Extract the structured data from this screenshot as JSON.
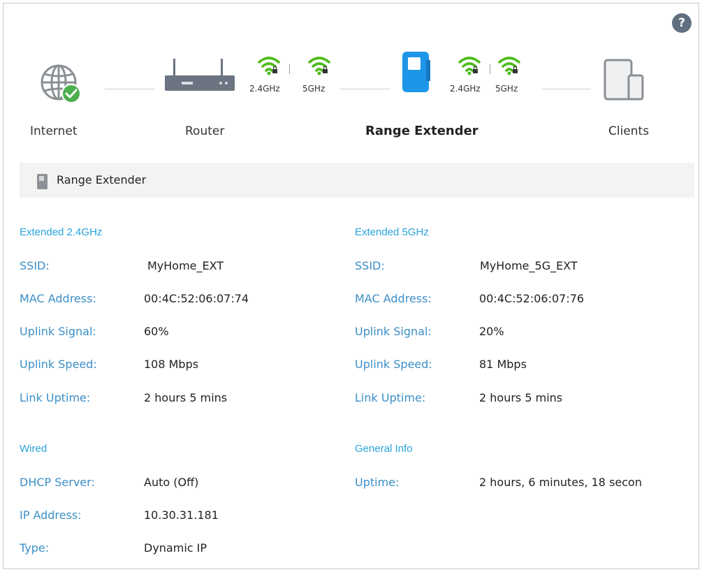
{
  "help": {
    "symbol": "?"
  },
  "topology": {
    "internet_label": "Internet",
    "router_label": "Router",
    "extender_label": "Range Extender",
    "clients_label": "Clients",
    "router_bands": [
      "2.4GHz",
      "5GHz"
    ],
    "extender_bands": [
      "2.4GHz",
      "5GHz"
    ],
    "accent_color": "#1e96e8",
    "wifi_color": "#4cbb17",
    "status_color": "#4cae4c"
  },
  "section": {
    "title": "Range Extender"
  },
  "ext24": {
    "title": "Extended 2.4GHz",
    "ssid_label": "SSID:",
    "ssid": "MyHome_EXT",
    "mac_label": "MAC Address:",
    "mac": "00:4C:52:06:07:74",
    "signal_label": "Uplink Signal:",
    "signal": "60%",
    "speed_label": "Uplink Speed:",
    "speed": "108 Mbps",
    "uptime_label": "Link Uptime:",
    "uptime": "2 hours 5 mins"
  },
  "ext5": {
    "title": "Extended 5GHz",
    "ssid_label": "SSID:",
    "ssid": "MyHome_5G_EXT",
    "mac_label": "MAC Address:",
    "mac": "00:4C:52:06:07:76",
    "signal_label": "Uplink Signal:",
    "signal": "20%",
    "speed_label": "Uplink Speed:",
    "speed": "81 Mbps",
    "uptime_label": "Link Uptime:",
    "uptime": "2 hours 5 mins"
  },
  "wired": {
    "title": "Wired",
    "dhcp_label": "DHCP Server:",
    "dhcp": "Auto (Off)",
    "ip_label": "IP Address:",
    "ip": "10.30.31.181",
    "type_label": "Type:",
    "type": "Dynamic IP"
  },
  "general": {
    "title": "General Info",
    "uptime_label": "Uptime:",
    "uptime": "2 hours, 6 minutes, 18 secon"
  }
}
